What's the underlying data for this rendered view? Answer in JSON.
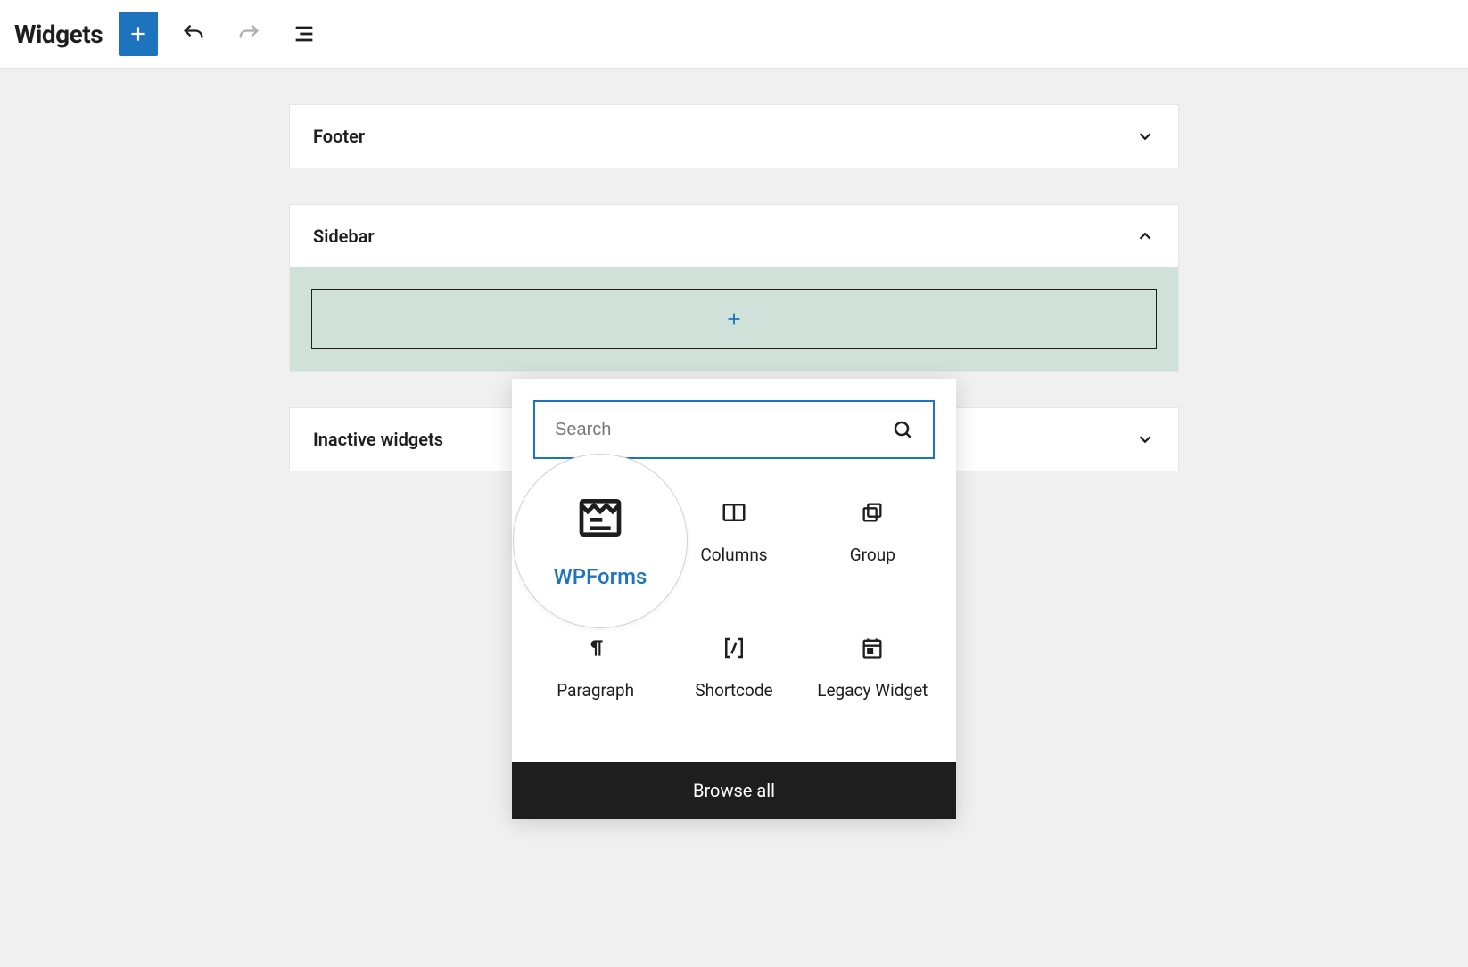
{
  "header": {
    "title": "Widgets"
  },
  "areas": {
    "footer": {
      "title": "Footer",
      "expanded": false
    },
    "sidebar": {
      "title": "Sidebar",
      "expanded": true
    },
    "inactive": {
      "title": "Inactive widgets",
      "expanded": false
    }
  },
  "inserter": {
    "search_placeholder": "Search",
    "browse_all_label": "Browse all",
    "blocks": [
      {
        "key": "wpforms",
        "label": "WPForms",
        "icon": "wpforms-icon"
      },
      {
        "key": "columns",
        "label": "Columns",
        "icon": "columns-icon"
      },
      {
        "key": "group",
        "label": "Group",
        "icon": "group-icon"
      },
      {
        "key": "paragraph",
        "label": "Paragraph",
        "icon": "paragraph-icon"
      },
      {
        "key": "shortcode",
        "label": "Shortcode",
        "icon": "shortcode-icon"
      },
      {
        "key": "legacy",
        "label": "Legacy Widget",
        "icon": "legacy-widget-icon"
      }
    ]
  },
  "colors": {
    "accent": "#1e73be",
    "highlight_bg": "#cfe1d8"
  }
}
